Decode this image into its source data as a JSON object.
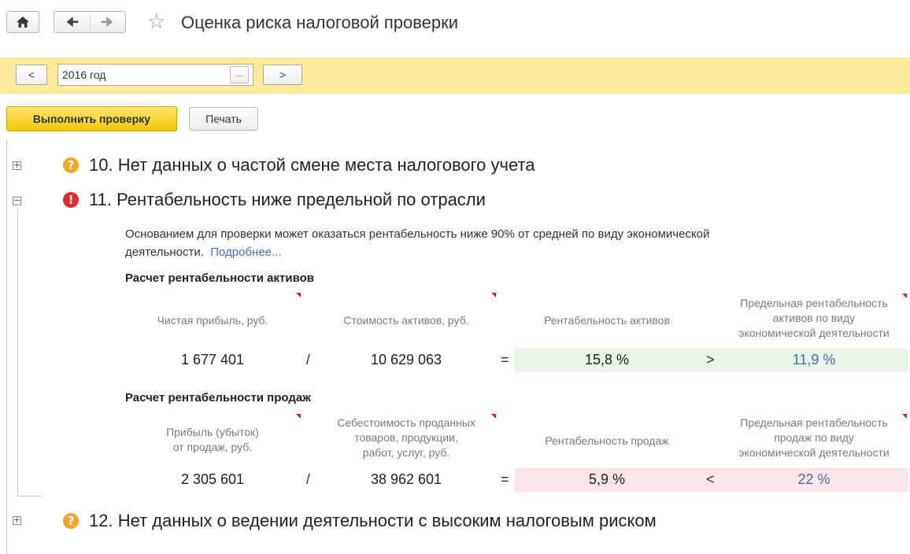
{
  "header": {
    "title": "Оценка риска налоговой проверки",
    "icons": {
      "home": "home-icon",
      "back": "arrow-left-icon",
      "forward": "arrow-right-icon",
      "favorite": "star-icon"
    }
  },
  "period": {
    "prev_label": "<",
    "value": "2016 год",
    "select_label": "...",
    "next_label": ">"
  },
  "toolbar": {
    "run_label": "Выполнить проверку",
    "print_label": "Печать"
  },
  "items": [
    {
      "number_title": "10. Нет данных о частой смене места налогового учета",
      "status": "warning",
      "expanded": false
    },
    {
      "number_title": "11. Рентабельность ниже предельной по отрасли",
      "status": "error",
      "expanded": true
    },
    {
      "number_title": "12. Нет данных о ведении деятельности с высоким налоговым риском",
      "status": "warning",
      "expanded": false
    }
  ],
  "detail": {
    "description": "Основанием для проверки может оказаться рентабельность ниже 90% от средней по виду экономической деятельности.",
    "more_link": "Подробнее...",
    "assets": {
      "title": "Расчет рентабельности активов",
      "col1": "Чистая прибыль, руб.",
      "col2": "Стоимость активов, руб.",
      "col3": "Рентабельность активов",
      "col4_l1": "Предельная рентабельность",
      "col4_l2": "активов по виду",
      "col4_l3": "экономической деятельности",
      "v1": "1 677 401",
      "div": "/",
      "v2": "10 629 063",
      "eq": "=",
      "v3": "15,8 %",
      "cmp": ">",
      "v4": "11,9 %"
    },
    "sales": {
      "title": "Расчет рентабельности продаж",
      "col1_l1": "Прибыль (убыток)",
      "col1_l2": "от продаж, руб.",
      "col2_l1": "Себестоимость проданных",
      "col2_l2": "товаров, продукции,",
      "col2_l3": "работ, услуг, руб.",
      "col3": "Рентабельность продаж",
      "col4_l1": "Предельная рентабельность",
      "col4_l2": "продаж по виду",
      "col4_l3": "экономической деятельности",
      "v1": "2 305 601",
      "div": "/",
      "v2": "38 962 601",
      "eq": "=",
      "v3": "5,9 %",
      "cmp": "<",
      "v4": "22 %"
    }
  }
}
